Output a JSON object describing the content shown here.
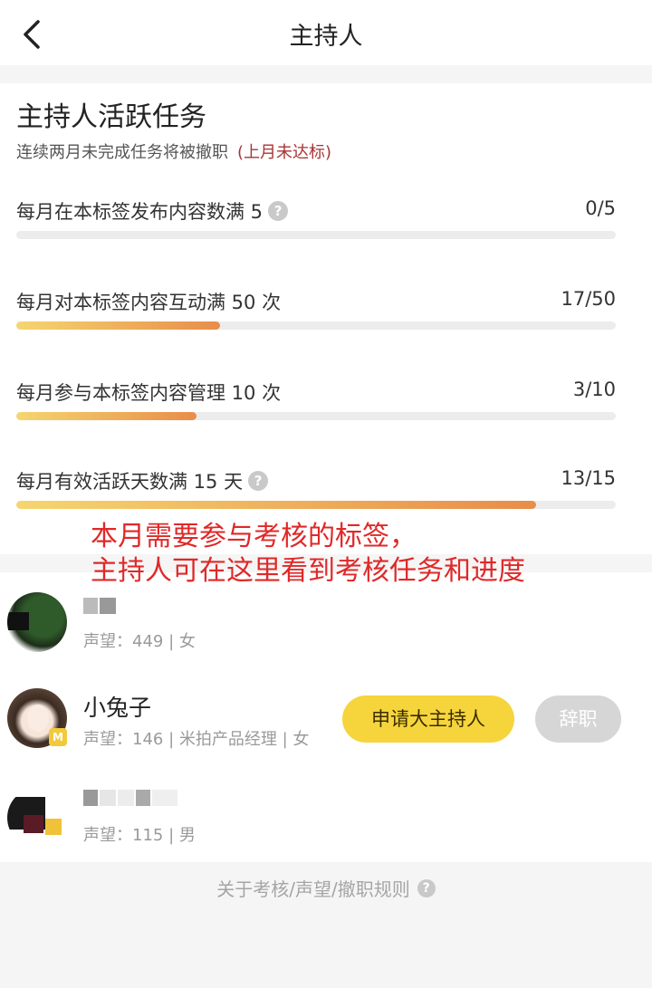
{
  "nav": {
    "title": "主持人"
  },
  "tasks_section": {
    "heading": "主持人活跃任务",
    "subtitle": "连续两月未完成任务将被撤职",
    "warning": "(上月未达标)",
    "tasks": [
      {
        "label": "每月在本标签发布内容数满 5",
        "count": "0/5",
        "progress": 0.0,
        "has_help": true
      },
      {
        "label": "每月对本标签内容互动满 50 次",
        "count": "17/50",
        "progress": 0.34,
        "has_help": false
      },
      {
        "label": "每月参与本标签内容管理 10 次",
        "count": "3/10",
        "progress": 0.3,
        "has_help": false
      },
      {
        "label": "每月有效活跃天数满 15 天",
        "count": "13/15",
        "progress": 0.867,
        "has_help": true
      }
    ]
  },
  "annotation": {
    "line1": "本月需要参与考核的标签，",
    "line2": "主持人可在这里看到考核任务和进度"
  },
  "hosts": [
    {
      "name": "",
      "meta": "声望：449 | 女"
    },
    {
      "name": "小兔子",
      "meta": "声望：146 | 米拍产品经理 | 女",
      "apply_label": "申请大主持人",
      "resign_label": "辞职"
    },
    {
      "name": "",
      "meta": "声望：115 | 男"
    }
  ],
  "footer": {
    "link": "关于考核/声望/撤职规则"
  },
  "colors": {
    "accent": "#f6d43c",
    "warning": "#a83434",
    "annotation": "#e02828",
    "progress_start": "#f5d66f",
    "progress_end": "#e88d4a"
  }
}
